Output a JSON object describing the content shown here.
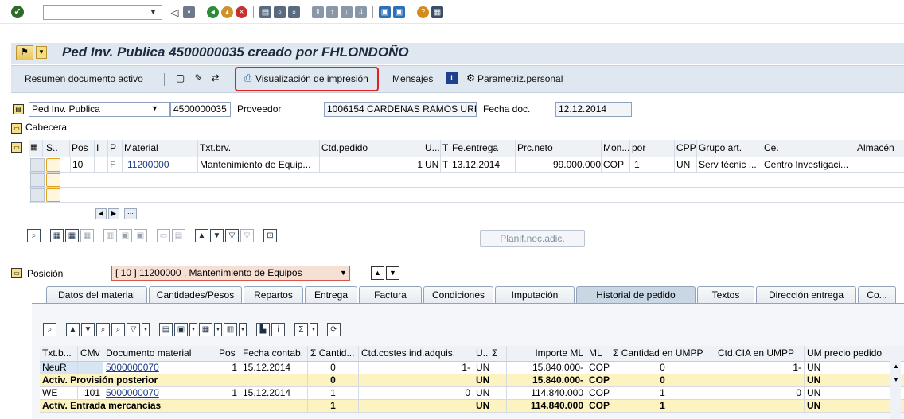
{
  "title": "Ped Inv. Publica 4500000035 creado por FHLONDOÑO",
  "toolbar": {
    "items": [
      {
        "label": "Resumen documento activo"
      },
      {
        "label": "Visualización de impresión"
      },
      {
        "label": "Mensajes"
      },
      {
        "label": "Parametriz.personal"
      }
    ]
  },
  "header": {
    "doc_type": "Ped Inv. Publica",
    "doc_number": "4500000035",
    "vendor_label": "Proveedor",
    "vendor_value": "1006154 CARDENAS RAMOS URI...",
    "date_label": "Fecha doc.",
    "date_value": "12.12.2014",
    "cabecera_label": "Cabecera"
  },
  "items_table": {
    "columns": [
      "S..",
      "Pos",
      "I",
      "P",
      "Material",
      "Txt.brv.",
      "Ctd.pedido",
      "U...",
      "T",
      "Fe.entrega",
      "Prc.neto",
      "Mon...",
      "por",
      "CPP",
      "Grupo art.",
      "Ce.",
      "Almacén"
    ],
    "rows": [
      {
        "pos": "10",
        "p": "F",
        "material": "11200000",
        "txt": "Mantenimiento de Equip...",
        "qty": "1",
        "unit": "UN",
        "t": "T",
        "delivery": "13.12.2014",
        "price": "99.000.000",
        "currency": "COP",
        "per": "1",
        "cpp": "UN",
        "group": "Serv técnic ...",
        "center": "Centro Investigaci..."
      }
    ]
  },
  "planif_button": "Planif.nec.adic.",
  "position": {
    "label": "Posición",
    "selected": "[ 10 ] 11200000 , Mantenimiento de Equipos"
  },
  "tabs": [
    {
      "label": "Datos del material"
    },
    {
      "label": "Cantidades/Pesos"
    },
    {
      "label": "Repartos"
    },
    {
      "label": "Entrega"
    },
    {
      "label": "Factura"
    },
    {
      "label": "Condiciones"
    },
    {
      "label": "Imputación"
    },
    {
      "label": "Historial de pedido"
    },
    {
      "label": "Textos"
    },
    {
      "label": "Dirección entrega"
    },
    {
      "label": "Co..."
    }
  ],
  "history": {
    "columns": [
      "Txt.b...",
      "CMv",
      "Documento material",
      "Pos",
      "Fecha contab.",
      "Σ Cantid...",
      "Ctd.costes ind.adquis.",
      "U...",
      "Σ",
      "Importe ML",
      "ML",
      "Σ Cantidad en UMPP",
      "Ctd.CIA en UMPP",
      "UM precio pedido"
    ],
    "rows": [
      {
        "type": "NeuR",
        "cmv": "",
        "doc": "5000000070",
        "pos": "1",
        "date": "15.12.2014",
        "qty": "0",
        "costs": "1-",
        "unit": "UN",
        "amount": "15.840.000-",
        "ml": "COP",
        "qty_umpp": "0",
        "cia_umpp": "1-",
        "um": "UN"
      },
      {
        "type": "Activ. Provisión posterior",
        "qty": "0",
        "unit": "UN",
        "amount": "15.840.000-",
        "ml": "COP",
        "qty_umpp": "0",
        "um": "UN",
        "sum": true
      },
      {
        "type": "WE",
        "cmv": "101",
        "doc": "5000000070",
        "pos": "1",
        "date": "15.12.2014",
        "qty": "1",
        "costs": "0",
        "unit": "UN",
        "amount": "114.840.000",
        "ml": "COP",
        "qty_umpp": "1",
        "cia_umpp": "0",
        "um": "UN"
      },
      {
        "type": "Activ. Entrada mercancías",
        "qty": "1",
        "unit": "UN",
        "amount": "114.840.000",
        "ml": "COP",
        "qty_umpp": "1",
        "um": "UN",
        "sum": true
      }
    ]
  },
  "colors": {
    "highlight": "#e02020",
    "toolbar_bg": "#dfe8f1",
    "sum_row": "#fdf3c0"
  }
}
